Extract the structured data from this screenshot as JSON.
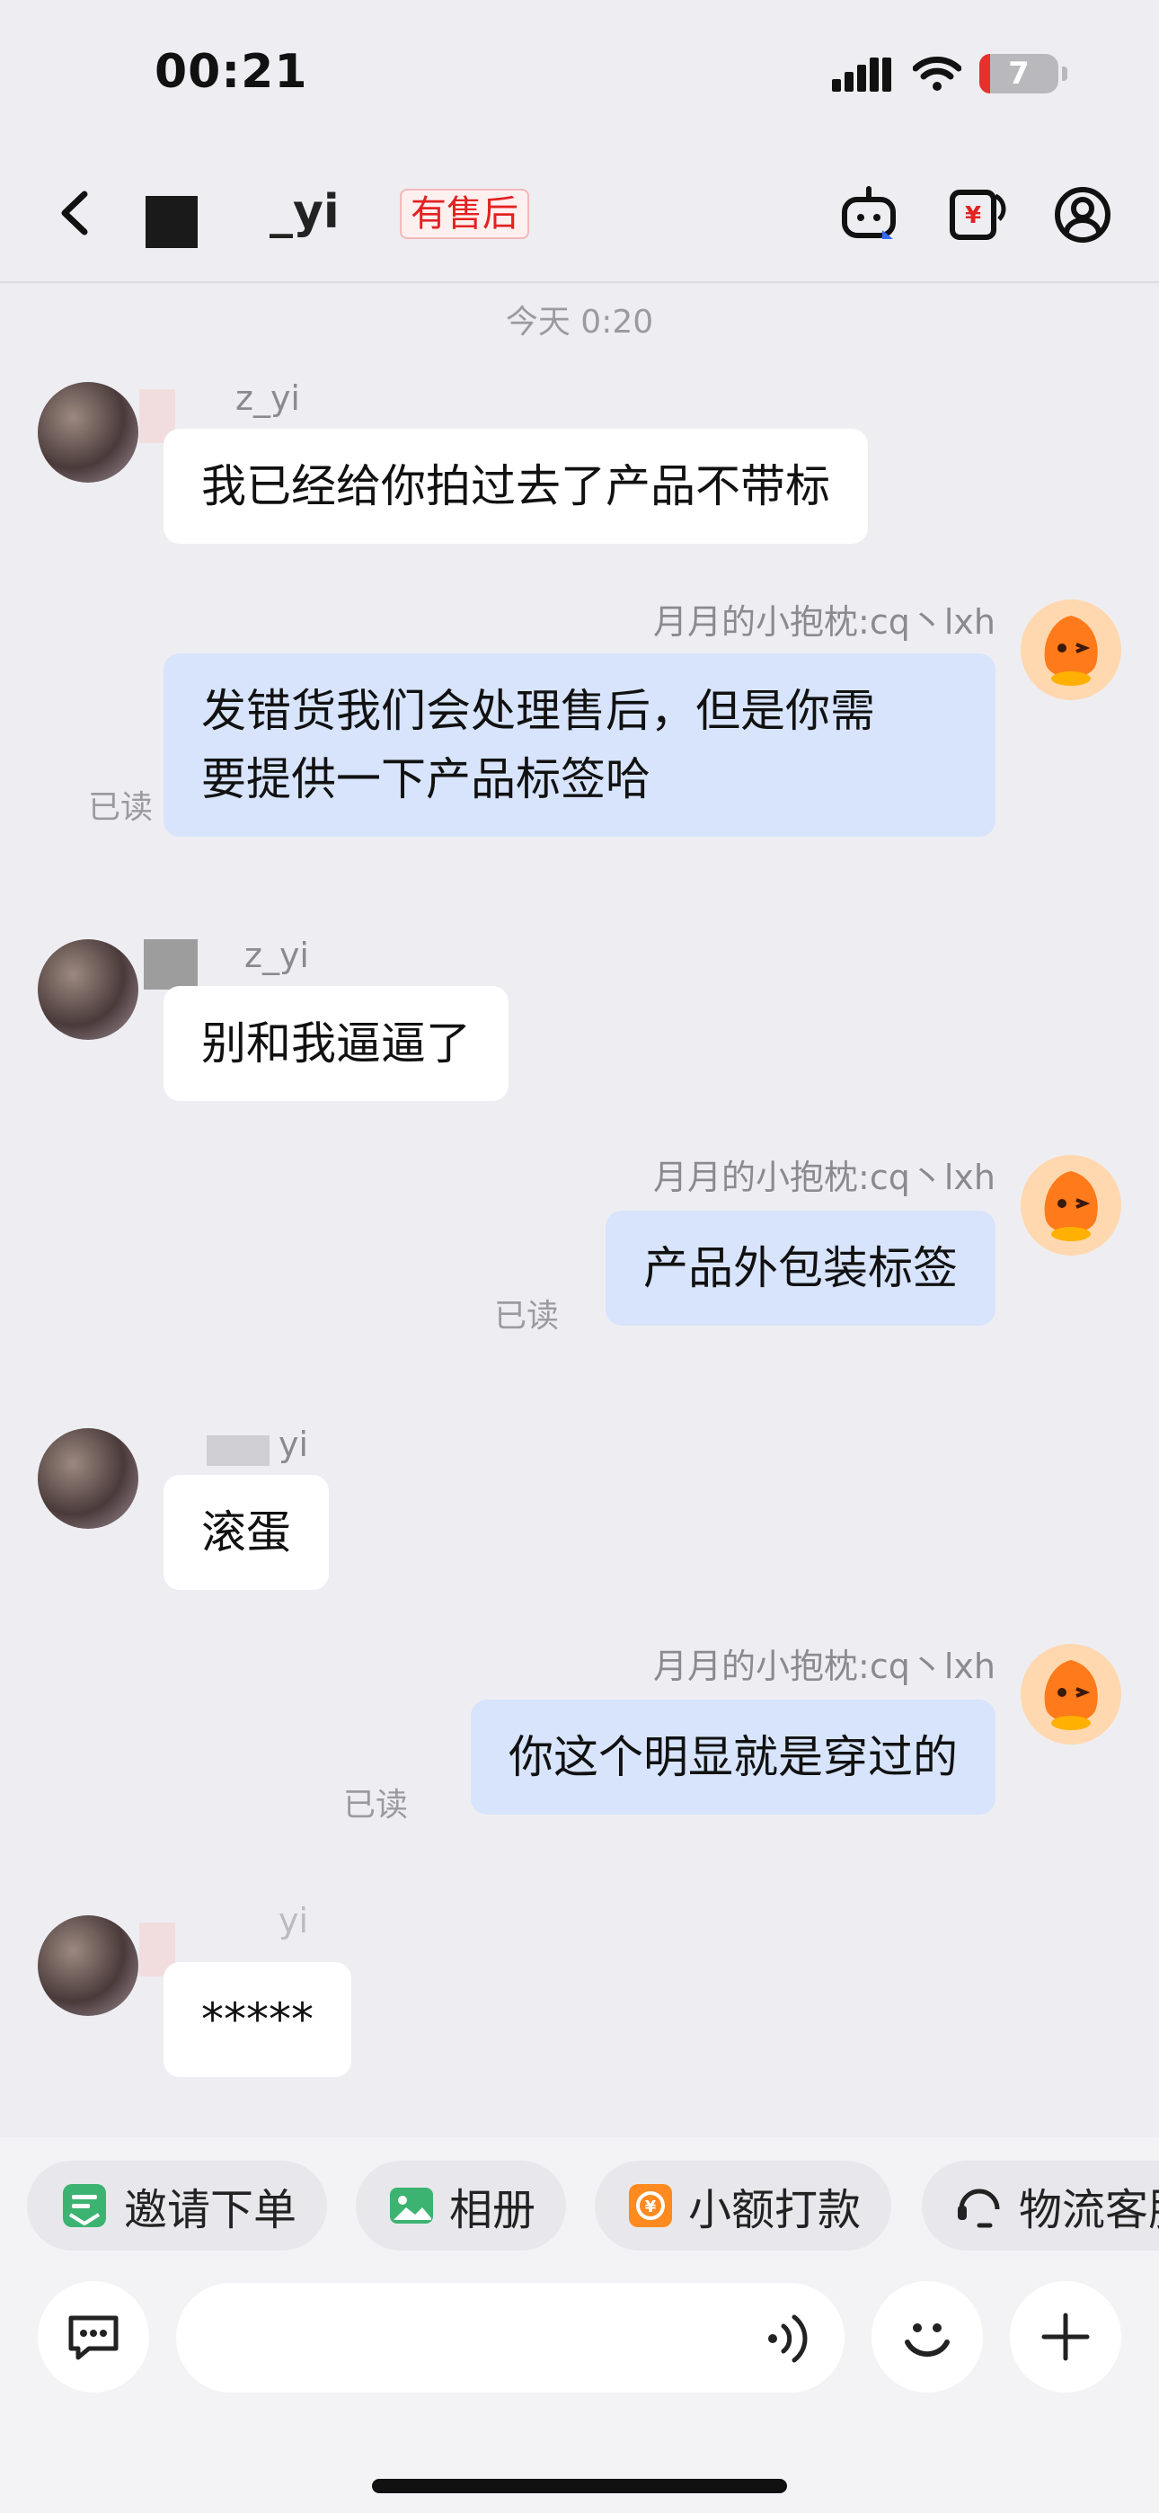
{
  "status_bar": {
    "time": "00:21",
    "battery": "7"
  },
  "header": {
    "title": "_yi",
    "badge": "有售后"
  },
  "chat": {
    "date_divider": "今天 0:20",
    "messages": [
      {
        "side": "in",
        "sender": "z_yi",
        "text": "我已经给你拍过去了产品不带标"
      },
      {
        "side": "out",
        "sender": "月月的小抱枕:cq丶lxh",
        "line1": "发错货我们会处理售后，但是你需",
        "line2": "要提供一下产品标签哈",
        "read": "已读"
      },
      {
        "side": "in",
        "sender": "z_yi",
        "text": "别和我逼逼了"
      },
      {
        "side": "out",
        "sender": "月月的小抱枕:cq丶lxh",
        "text": "产品外包装标签",
        "read": "已读"
      },
      {
        "side": "in",
        "sender": "yi",
        "text": "滚蛋"
      },
      {
        "side": "out",
        "sender": "月月的小抱枕:cq丶lxh",
        "text": "你这个明显就是穿过的",
        "read": "已读"
      },
      {
        "side": "in",
        "sender": "yi",
        "text": "*****"
      }
    ]
  },
  "quick_actions": [
    {
      "label": "邀请下单",
      "icon": "invite-order-icon",
      "color": "#3cb371"
    },
    {
      "label": "相册",
      "icon": "album-icon",
      "color": "#3cb371"
    },
    {
      "label": "小额打款",
      "icon": "small-payment-icon",
      "color": "#ff8a1f"
    },
    {
      "label": "物流客服",
      "icon": "logistics-service-icon",
      "color": "#222222"
    }
  ],
  "input": {
    "placeholder": ""
  },
  "colors": {
    "outgoing_bubble": "#d7e4fc",
    "incoming_bubble": "#ffffff",
    "badge_red": "#e32222"
  }
}
